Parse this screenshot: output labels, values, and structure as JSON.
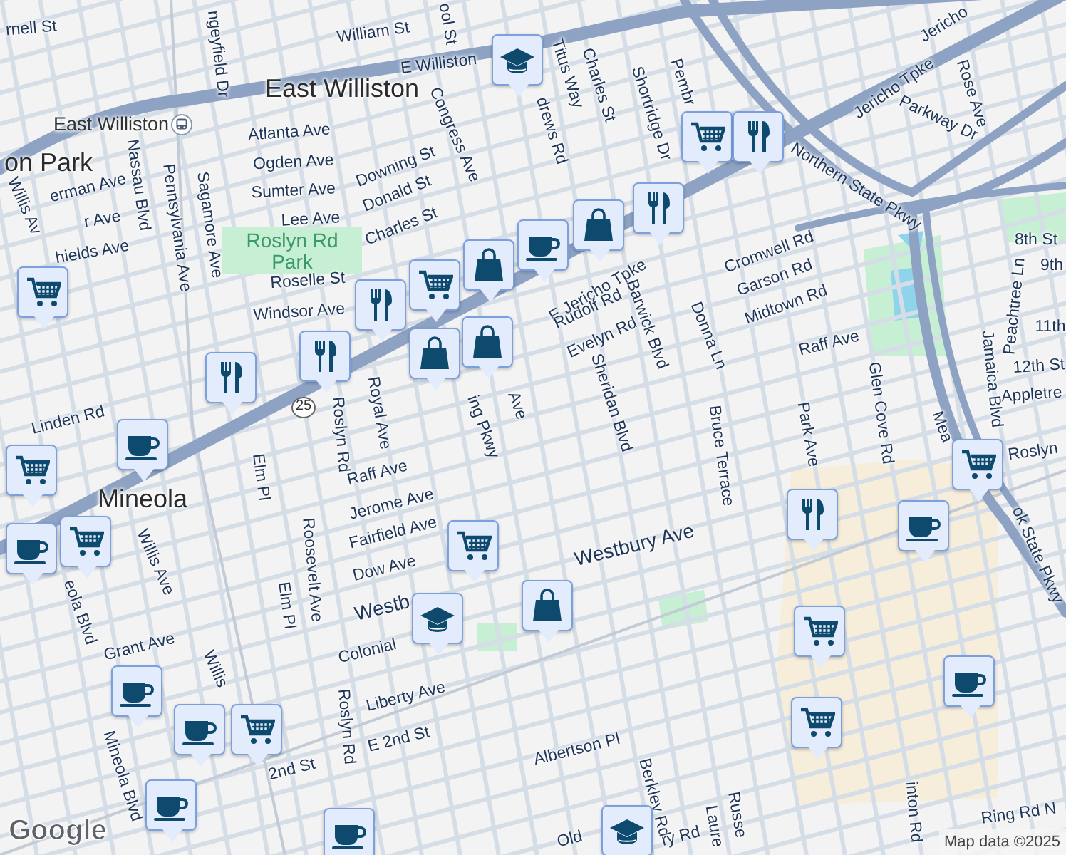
{
  "map": {
    "labels": [
      {
        "text": "rnell St",
        "kind": "street"
      },
      {
        "text": "ngeyfield Dr",
        "kind": "street"
      },
      {
        "text": "William St",
        "kind": "street"
      },
      {
        "text": "ool St",
        "kind": "street"
      },
      {
        "text": "E Williston",
        "kind": "street"
      },
      {
        "text": "East Williston",
        "kind": "place"
      },
      {
        "text": "drews Rd",
        "kind": "street"
      },
      {
        "text": "Titus Way",
        "kind": "street"
      },
      {
        "text": "Charles St",
        "kind": "street"
      },
      {
        "text": "Shortridge Dr",
        "kind": "street"
      },
      {
        "text": "Pembr",
        "kind": "street"
      },
      {
        "text": "Jericho",
        "kind": "street"
      },
      {
        "text": "Jericho Tpke",
        "kind": "street"
      },
      {
        "text": "Rose Ave",
        "kind": "street"
      },
      {
        "text": "Parkway Dr",
        "kind": "street"
      },
      {
        "text": "Northern State Pkwy",
        "kind": "street"
      },
      {
        "text": "East Williston",
        "kind": "station"
      },
      {
        "text": "on Park",
        "kind": "place"
      },
      {
        "text": "Atlanta Ave",
        "kind": "street"
      },
      {
        "text": "Congress Ave",
        "kind": "street"
      },
      {
        "text": "Ogden Ave",
        "kind": "street"
      },
      {
        "text": "Downing St",
        "kind": "street"
      },
      {
        "text": "Sumter Ave",
        "kind": "street"
      },
      {
        "text": "Donald St",
        "kind": "street"
      },
      {
        "text": "Lee Ave",
        "kind": "street"
      },
      {
        "text": "Charles St",
        "kind": "street"
      },
      {
        "text": "Nassau Blvd",
        "kind": "street"
      },
      {
        "text": "Pennsylvania Ave",
        "kind": "street"
      },
      {
        "text": "Sagamore Ave",
        "kind": "street"
      },
      {
        "text": "erman Ave",
        "kind": "street"
      },
      {
        "text": "r Ave",
        "kind": "street"
      },
      {
        "text": "hields Ave",
        "kind": "street"
      },
      {
        "text": "Willis Av",
        "kind": "street"
      },
      {
        "text": "Roslyn Rd Park",
        "kind": "park"
      },
      {
        "text": "Roselle St",
        "kind": "street"
      },
      {
        "text": "Windsor Ave",
        "kind": "street"
      },
      {
        "text": "Cromwell Rd",
        "kind": "street"
      },
      {
        "text": "Garson Rd",
        "kind": "street"
      },
      {
        "text": "Midtown Rd",
        "kind": "street"
      },
      {
        "text": "8th St",
        "kind": "street"
      },
      {
        "text": "9th",
        "kind": "street"
      },
      {
        "text": "11th",
        "kind": "street"
      },
      {
        "text": "Peachtree Ln",
        "kind": "street"
      },
      {
        "text": "12th St",
        "kind": "street"
      },
      {
        "text": "Appletre",
        "kind": "street"
      },
      {
        "text": "Jamaica Blvd",
        "kind": "street"
      },
      {
        "text": "E Jericho Tpke",
        "kind": "street"
      },
      {
        "text": "Rudolf Rd",
        "kind": "street"
      },
      {
        "text": "Evelyn Rd",
        "kind": "street"
      },
      {
        "text": "Barwick Blvd",
        "kind": "street"
      },
      {
        "text": "Donna Ln",
        "kind": "street"
      },
      {
        "text": "Raff Ave",
        "kind": "street"
      },
      {
        "text": "Sheridan Blvd",
        "kind": "street"
      },
      {
        "text": "Royal Ave",
        "kind": "street"
      },
      {
        "text": "ing Pkwy",
        "kind": "street"
      },
      {
        "text": "Ave",
        "kind": "street"
      },
      {
        "text": "25",
        "kind": "shield"
      },
      {
        "text": "Glen Cove Rd",
        "kind": "street"
      },
      {
        "text": "Park Ave",
        "kind": "street"
      },
      {
        "text": "Bruce Terrace",
        "kind": "street"
      },
      {
        "text": "Roslyn",
        "kind": "street"
      },
      {
        "text": "Linden Rd",
        "kind": "street"
      },
      {
        "text": "Mineola",
        "kind": "place"
      },
      {
        "text": "Elm Pl",
        "kind": "street"
      },
      {
        "text": "Roslyn Rd",
        "kind": "street"
      },
      {
        "text": "Raff Ave",
        "kind": "street"
      },
      {
        "text": "Jerome Ave",
        "kind": "street"
      },
      {
        "text": "Fairfield Ave",
        "kind": "street"
      },
      {
        "text": "Dow Ave",
        "kind": "street"
      },
      {
        "text": "Westbury Ave",
        "kind": "major"
      },
      {
        "text": "Willis Ave",
        "kind": "street"
      },
      {
        "text": "Elm Pl",
        "kind": "street"
      },
      {
        "text": "Roosevelt Ave",
        "kind": "street"
      },
      {
        "text": "eola Blvd",
        "kind": "street"
      },
      {
        "text": "ok State Pkwy",
        "kind": "street"
      },
      {
        "text": "Mea",
        "kind": "street"
      },
      {
        "text": "Grant Ave",
        "kind": "street"
      },
      {
        "text": "Colonial",
        "kind": "street"
      },
      {
        "text": "Roslyn Rd",
        "kind": "street"
      },
      {
        "text": "Willis",
        "kind": "street"
      },
      {
        "text": "Liberty Ave",
        "kind": "street"
      },
      {
        "text": "E 2nd St",
        "kind": "street"
      },
      {
        "text": "2nd St",
        "kind": "street"
      },
      {
        "text": "Albertson Pl",
        "kind": "street"
      },
      {
        "text": "Berkley Rd",
        "kind": "street"
      },
      {
        "text": "Ring Rd N",
        "kind": "street"
      },
      {
        "text": "inton Rd",
        "kind": "street"
      },
      {
        "text": "Mineola Blvd",
        "kind": "street"
      },
      {
        "text": "Old",
        "kind": "street"
      },
      {
        "text": "ry Rd",
        "kind": "street"
      },
      {
        "text": "Russe",
        "kind": "street"
      },
      {
        "text": "Laure",
        "kind": "street"
      },
      {
        "text": "Westb",
        "kind": "major"
      }
    ],
    "pins": [
      {
        "kind": "school"
      },
      {
        "kind": "cart"
      },
      {
        "kind": "food"
      },
      {
        "kind": "food"
      },
      {
        "kind": "bag"
      },
      {
        "kind": "cup"
      },
      {
        "kind": "cart"
      },
      {
        "kind": "bag"
      },
      {
        "kind": "bag"
      },
      {
        "kind": "food"
      },
      {
        "kind": "food"
      },
      {
        "kind": "bag"
      },
      {
        "kind": "food"
      },
      {
        "kind": "cart"
      },
      {
        "kind": "cup"
      },
      {
        "kind": "cart"
      },
      {
        "kind": "cart"
      },
      {
        "kind": "cup"
      },
      {
        "kind": "cart"
      },
      {
        "kind": "school"
      },
      {
        "kind": "bag"
      },
      {
        "kind": "food"
      },
      {
        "kind": "cup"
      },
      {
        "kind": "cart"
      },
      {
        "kind": "cart"
      },
      {
        "kind": "cup"
      },
      {
        "kind": "cart"
      },
      {
        "kind": "cup"
      },
      {
        "kind": "cup"
      },
      {
        "kind": "cup"
      },
      {
        "kind": "cart"
      },
      {
        "kind": "cup"
      },
      {
        "kind": "school"
      }
    ],
    "logo": "Google",
    "attribution": "Map data ©2025"
  }
}
